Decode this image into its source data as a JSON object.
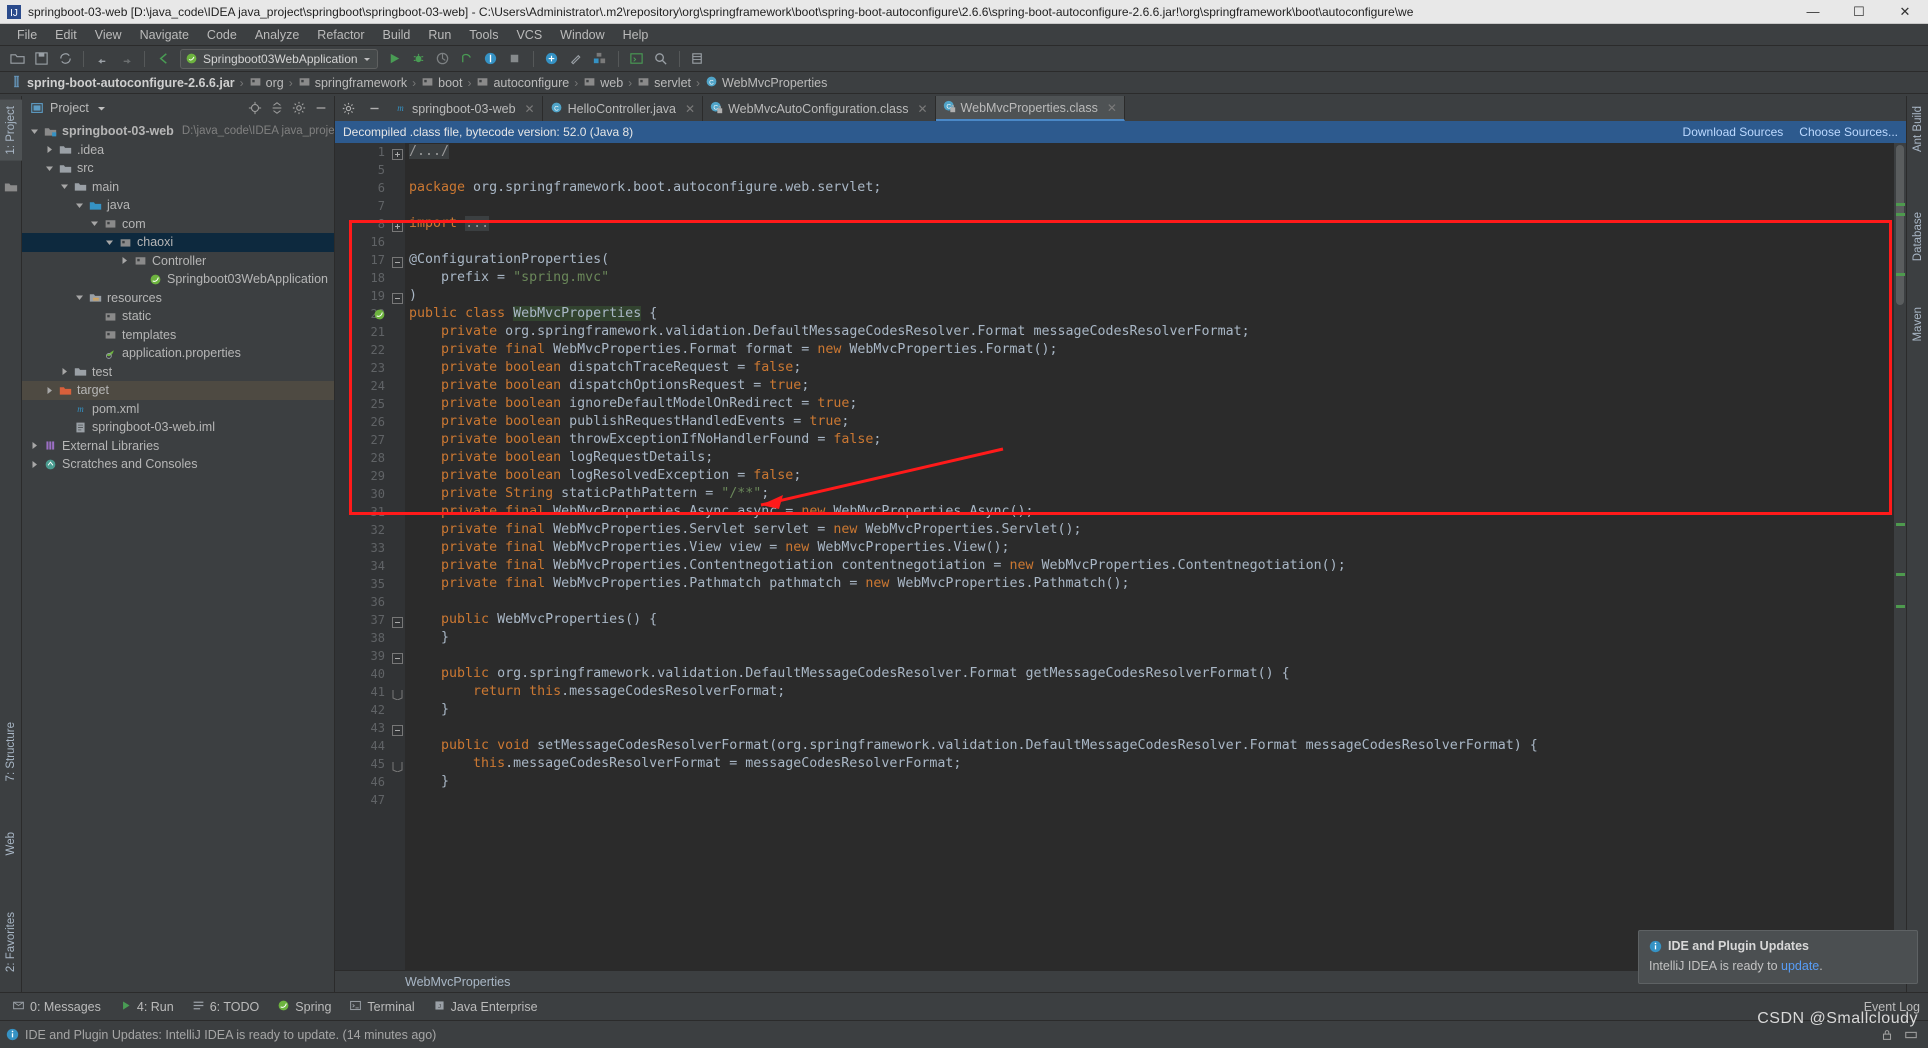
{
  "window": {
    "title": "springboot-03-web [D:\\java_code\\IDEA java_project\\springboot\\springboot-03-web] - C:\\Users\\Administrator\\.m2\\repository\\org\\springframework\\boot\\spring-boot-autoconfigure\\2.6.6\\spring-boot-autoconfigure-2.6.6.jar!\\org\\springframework\\boot\\autoconfigure\\we",
    "minimize": "—",
    "maximize": "☐",
    "close": "✕"
  },
  "menu": [
    "File",
    "Edit",
    "View",
    "Navigate",
    "Code",
    "Analyze",
    "Refactor",
    "Build",
    "Run",
    "Tools",
    "VCS",
    "Window",
    "Help"
  ],
  "toolbar": {
    "run_config": "Springboot03WebApplication"
  },
  "breadcrumb": [
    {
      "label": "spring-boot-autoconfigure-2.6.6.jar",
      "icon": "jar-icon",
      "bold": true
    },
    {
      "label": "org",
      "icon": "package-icon",
      "bold": false
    },
    {
      "label": "springframework",
      "icon": "package-icon",
      "bold": false
    },
    {
      "label": "boot",
      "icon": "package-icon",
      "bold": false
    },
    {
      "label": "autoconfigure",
      "icon": "package-icon",
      "bold": false
    },
    {
      "label": "web",
      "icon": "package-icon",
      "bold": false
    },
    {
      "label": "servlet",
      "icon": "package-icon",
      "bold": false
    },
    {
      "label": "WebMvcProperties",
      "icon": "class-icon",
      "bold": false
    }
  ],
  "left_strip": [
    {
      "label": "1: Project",
      "icon": "project-icon",
      "selected": true
    },
    {
      "label": "7: Structure",
      "icon": "structure-icon",
      "selected": false
    },
    {
      "label": "Web",
      "icon": "web-icon",
      "selected": false
    },
    {
      "label": "2: Favorites",
      "icon": "star-icon",
      "selected": false
    }
  ],
  "right_strip": [
    "Ant Build",
    "Database",
    "Maven"
  ],
  "project_panel": {
    "title": "Project",
    "tree": [
      {
        "indent": 0,
        "arrow": "down",
        "icon": "module-icon",
        "label": "springboot-03-web",
        "sub": "D:\\java_code\\IDEA java_project\\spring",
        "bold": true,
        "selected": false
      },
      {
        "indent": 1,
        "arrow": "right",
        "icon": "folder-icon",
        "label": ".idea",
        "sub": "",
        "bold": false,
        "selected": false
      },
      {
        "indent": 1,
        "arrow": "down",
        "icon": "folder-icon",
        "label": "src",
        "sub": "",
        "bold": false,
        "selected": false
      },
      {
        "indent": 2,
        "arrow": "down",
        "icon": "folder-icon",
        "label": "main",
        "sub": "",
        "bold": false,
        "selected": false
      },
      {
        "indent": 3,
        "arrow": "down",
        "icon": "source-icon",
        "label": "java",
        "sub": "",
        "bold": false,
        "selected": false
      },
      {
        "indent": 4,
        "arrow": "down",
        "icon": "package-icon",
        "label": "com",
        "sub": "",
        "bold": false,
        "selected": false
      },
      {
        "indent": 5,
        "arrow": "down",
        "icon": "package-icon",
        "label": "chaoxi",
        "sub": "",
        "bold": false,
        "selected": true
      },
      {
        "indent": 6,
        "arrow": "right",
        "icon": "package-icon",
        "label": "Controller",
        "sub": "",
        "bold": false,
        "selected": false
      },
      {
        "indent": 7,
        "arrow": "none",
        "icon": "spring-icon",
        "label": "Springboot03WebApplication",
        "sub": "",
        "bold": false,
        "selected": false
      },
      {
        "indent": 3,
        "arrow": "down",
        "icon": "resource-icon",
        "label": "resources",
        "sub": "",
        "bold": false,
        "selected": false
      },
      {
        "indent": 4,
        "arrow": "none",
        "icon": "package-icon",
        "label": "static",
        "sub": "",
        "bold": false,
        "selected": false
      },
      {
        "indent": 4,
        "arrow": "none",
        "icon": "package-icon",
        "label": "templates",
        "sub": "",
        "bold": false,
        "selected": false
      },
      {
        "indent": 4,
        "arrow": "none",
        "icon": "props-icon",
        "label": "application.properties",
        "sub": "",
        "bold": false,
        "selected": false
      },
      {
        "indent": 2,
        "arrow": "right",
        "icon": "folder-icon",
        "label": "test",
        "sub": "",
        "bold": false,
        "selected": false
      },
      {
        "indent": 1,
        "arrow": "right",
        "icon": "target-icon",
        "label": "target",
        "sub": "",
        "bold": false,
        "selected": false,
        "altsel": true
      },
      {
        "indent": 2,
        "arrow": "none",
        "icon": "maven-icon",
        "label": "pom.xml",
        "sub": "",
        "bold": false,
        "selected": false
      },
      {
        "indent": 2,
        "arrow": "none",
        "icon": "iml-icon",
        "label": "springboot-03-web.iml",
        "sub": "",
        "bold": false,
        "selected": false
      },
      {
        "indent": 0,
        "arrow": "right",
        "icon": "library-icon",
        "label": "External Libraries",
        "sub": "",
        "bold": false,
        "selected": false
      },
      {
        "indent": 0,
        "arrow": "right",
        "icon": "scratch-icon",
        "label": "Scratches and Consoles",
        "sub": "",
        "bold": false,
        "selected": false
      }
    ]
  },
  "editor_tabs": [
    {
      "label": "springboot-03-web",
      "icon": "maven-icon",
      "active": false
    },
    {
      "label": "HelloController.java",
      "icon": "class-icon",
      "active": false
    },
    {
      "label": "WebMvcAutoConfiguration.class",
      "icon": "classfile-icon",
      "active": false
    },
    {
      "label": "WebMvcProperties.class",
      "icon": "classfile-icon",
      "active": true
    }
  ],
  "notice": {
    "text": "Decompiled .class file, bytecode version: 52.0 (Java 8)",
    "download_sources": "Download Sources",
    "choose_sources": "Choose Sources..."
  },
  "code": {
    "line_numbers": [
      "1",
      "5",
      "6",
      "7",
      "8",
      "16",
      "17",
      "18",
      "19",
      "20",
      "21",
      "22",
      "23",
      "24",
      "25",
      "26",
      "27",
      "28",
      "29",
      "30",
      "31",
      "32",
      "33",
      "34",
      "35",
      "36",
      "37",
      "38",
      "39",
      "40",
      "41",
      "42",
      "43",
      "44",
      "45",
      "46",
      "47"
    ],
    "lines": [
      "/.../",
      "",
      "package org.springframework.boot.autoconfigure.web.servlet;",
      "",
      "import ...",
      "",
      "@ConfigurationProperties(",
      "    prefix = \"spring.mvc\"",
      ")",
      "public class WebMvcProperties {",
      "    private org.springframework.validation.DefaultMessageCodesResolver.Format messageCodesResolverFormat;",
      "    private final WebMvcProperties.Format format = new WebMvcProperties.Format();",
      "    private boolean dispatchTraceRequest = false;",
      "    private boolean dispatchOptionsRequest = true;",
      "    private boolean ignoreDefaultModelOnRedirect = true;",
      "    private boolean publishRequestHandledEvents = true;",
      "    private boolean throwExceptionIfNoHandlerFound = false;",
      "    private boolean logRequestDetails;",
      "    private boolean logResolvedException = false;",
      "    private String staticPathPattern = \"/**\";",
      "    private final WebMvcProperties.Async async = new WebMvcProperties.Async();",
      "    private final WebMvcProperties.Servlet servlet = new WebMvcProperties.Servlet();",
      "    private final WebMvcProperties.View view = new WebMvcProperties.View();",
      "    private final WebMvcProperties.Contentnegotiation contentnegotiation = new WebMvcProperties.Contentnegotiation();",
      "    private final WebMvcProperties.Pathmatch pathmatch = new WebMvcProperties.Pathmatch();",
      "",
      "    public WebMvcProperties() {",
      "    }",
      "",
      "    public org.springframework.validation.DefaultMessageCodesResolver.Format getMessageCodesResolverFormat() {",
      "        return this.messageCodesResolverFormat;",
      "    }",
      "",
      "    public void setMessageCodesResolverFormat(org.springframework.validation.DefaultMessageCodesResolver.Format messageCodesResolverFormat) {",
      "        this.messageCodesResolverFormat = messageCodesResolverFormat;",
      "    }",
      ""
    ],
    "footer_breadcrumb": "WebMvcProperties"
  },
  "popup": {
    "title": "IDE and Plugin Updates",
    "body_prefix": "IntelliJ IDEA is ready to ",
    "body_link": "update",
    "body_suffix": "."
  },
  "bottom_tools": [
    {
      "label": "0: Messages",
      "icon": "messages-icon"
    },
    {
      "label": "4: Run",
      "icon": "run-icon"
    },
    {
      "label": "6: TODO",
      "icon": "todo-icon"
    },
    {
      "label": "Spring",
      "icon": "spring-icon"
    },
    {
      "label": "Terminal",
      "icon": "terminal-icon"
    },
    {
      "label": "Java Enterprise",
      "icon": "java-icon"
    }
  ],
  "bottom_right": "Event Log",
  "status": {
    "message": "IDE and Plugin Updates: IntelliJ IDEA is ready to update. (14 minutes ago)"
  },
  "watermark": "CSDN @Smallcloudy",
  "colors": {
    "accent_blue": "#4a88c7",
    "notice_blue": "#2d5a8e",
    "annotation_red": "#ff1a1a",
    "keyword_orange": "#cc7832",
    "string_green": "#6a8759",
    "selection_navy": "#0d293e"
  }
}
